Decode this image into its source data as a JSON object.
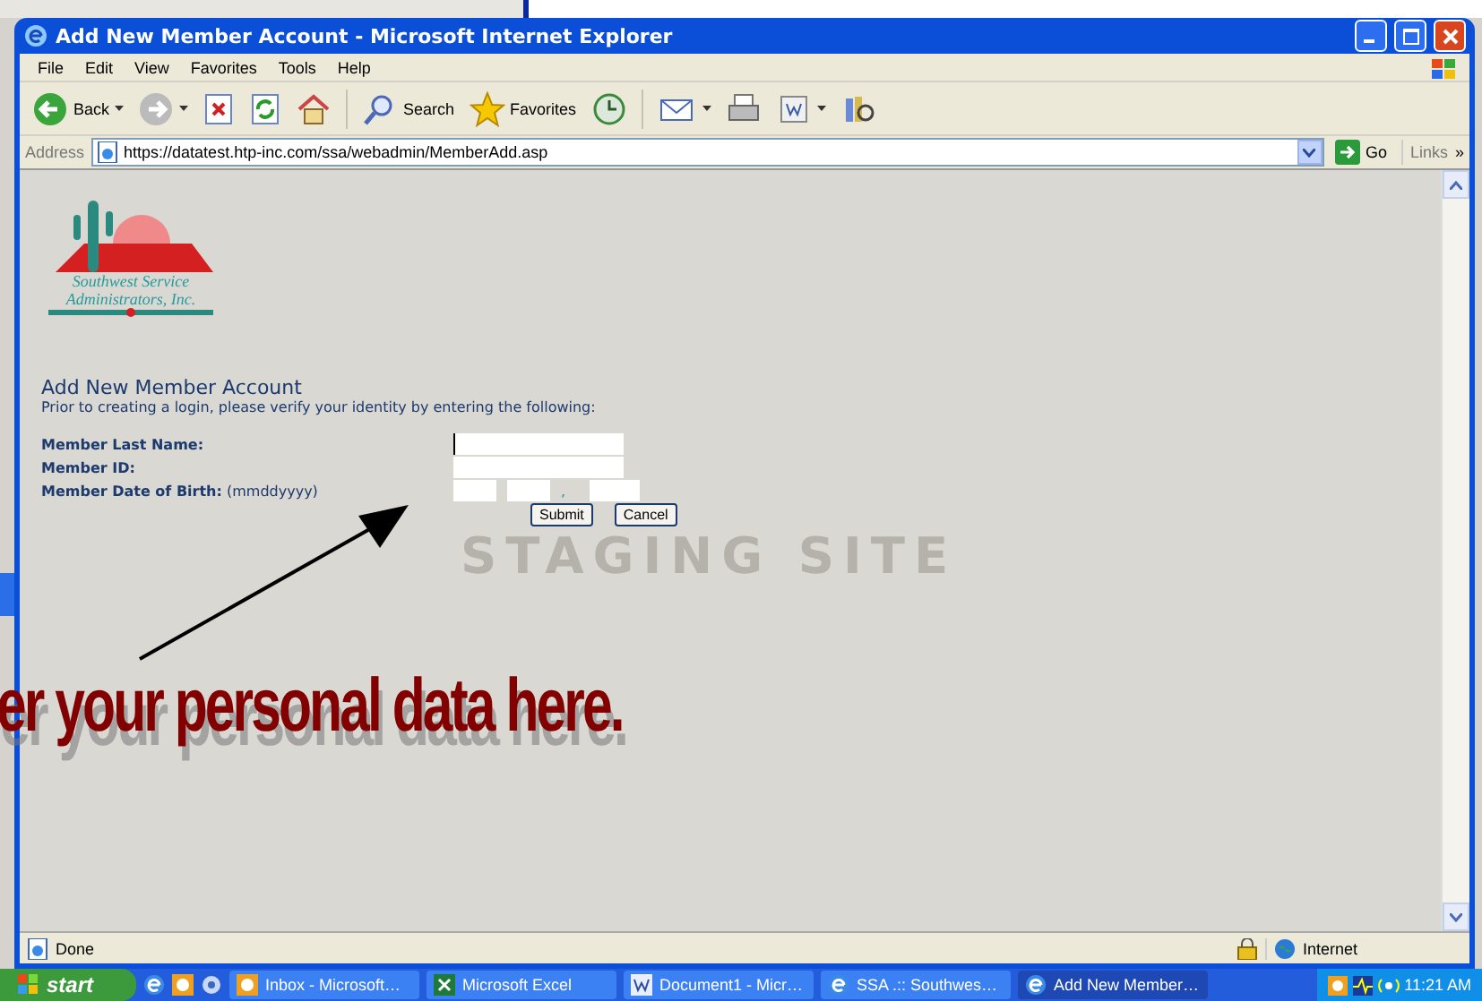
{
  "window": {
    "title": "Add New Member Account - Microsoft Internet Explorer"
  },
  "menu": [
    "File",
    "Edit",
    "View",
    "Favorites",
    "Tools",
    "Help"
  ],
  "toolbar": [
    {
      "kind": "back",
      "label": "Back",
      "disabled": false
    },
    {
      "kind": "forward",
      "disabled": true
    },
    {
      "kind": "stop"
    },
    {
      "kind": "refresh"
    },
    {
      "kind": "home"
    },
    {
      "kind": "search",
      "label": "Search"
    },
    {
      "kind": "favorites",
      "label": "Favorites"
    },
    {
      "kind": "history"
    },
    {
      "kind": "mail"
    },
    {
      "kind": "print"
    },
    {
      "kind": "edit"
    },
    {
      "kind": "research"
    }
  ],
  "address": {
    "label": "Address",
    "url": "https://datatest.htp-inc.com/ssa/webadmin/MemberAdd.asp",
    "go": "Go",
    "links": "Links",
    "chevron": "»"
  },
  "page": {
    "logo": {
      "line1": "Southwest Service",
      "line2": "Administrators, Inc."
    },
    "heading": "Add New Member Account",
    "intro": "Prior to creating a login, please verify your identity by entering the following:",
    "fields": [
      {
        "kind": "text",
        "label": "Member Last Name:",
        "focused": true
      },
      {
        "kind": "text",
        "label": "Member ID:",
        "focused": false
      },
      {
        "kind": "date",
        "label": "Member Date of Birth:",
        "hint": "(mmddyyyy)",
        "separator": ","
      }
    ],
    "buttons": [
      "Submit",
      "Cancel"
    ],
    "staging": "STAGING SITE"
  },
  "annotation": "er your personal data here.",
  "status": {
    "text": "Done",
    "zone": "Internet"
  },
  "taskbar": {
    "start": "start",
    "tasks": [
      {
        "label": "Inbox - Microsoft…",
        "kind": "outlook",
        "selected": false
      },
      {
        "label": "Microsoft Excel",
        "kind": "excel",
        "selected": false
      },
      {
        "label": "Document1 - Micr…",
        "kind": "word",
        "selected": false
      },
      {
        "label": "SSA .:: Southwes…",
        "kind": "ie",
        "selected": false
      },
      {
        "label": "Add New Member…",
        "kind": "ie",
        "selected": true
      }
    ],
    "clock": "11:21 AM"
  }
}
